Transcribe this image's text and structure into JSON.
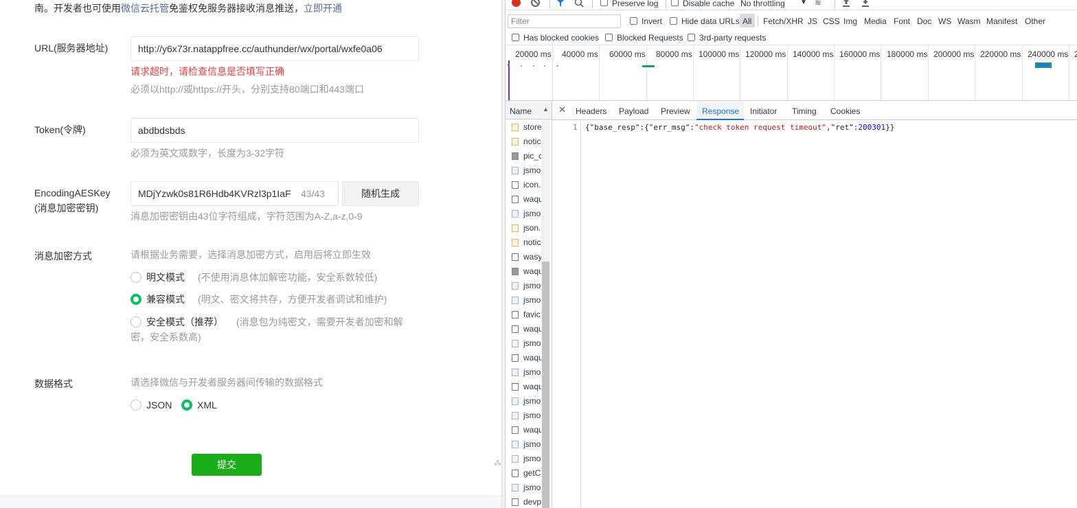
{
  "form": {
    "top_note": {
      "prefix": "南。开发者也可使用",
      "link1": "微信云托管",
      "middle": "免鉴权免服务器接收消息推送，",
      "link2": "立即开通"
    },
    "url": {
      "label": "URL(服务器地址)",
      "value": "http://y6x73r.natappfree.cc/authunder/wx/portal/wxfe0a06",
      "error": "请求超时，请检查信息是否填写正确",
      "hint": "必须以http://或https://开头，分别支持80端口和443端口"
    },
    "token": {
      "label": "Token(令牌)",
      "value": "abdbdsbds",
      "hint": "必须为英文或数字，长度为3-32字符"
    },
    "aeskey": {
      "label_line1": "EncodingAESKey",
      "label_line2": "(消息加密密钥)",
      "value": "MDjYzwk0s81R6Hdb4KVRzl3p1IaF",
      "counter": "43/43",
      "generate_button": "随机生成",
      "hint": "消息加密密钥由43位字符组成，字符范围为A-Z,a-z,0-9"
    },
    "encryption": {
      "label": "消息加密方式",
      "hint": "请根据业务需要，选择消息加密方式，启用后将立即生效",
      "options": [
        {
          "label": "明文模式",
          "desc": "(不使用消息体加解密功能，安全系数较低)",
          "selected": false
        },
        {
          "label": "兼容模式",
          "desc": "(明文、密文将共存，方便开发者调试和维护)",
          "selected": true
        },
        {
          "label": "安全模式（推荐）",
          "desc_line1": "(消息包为纯密文，需要开发者加密和解",
          "desc_line2": "密，安全系数高)",
          "selected": false
        }
      ]
    },
    "format": {
      "label": "数据格式",
      "hint": "请选择微信与开发者服务器间传输的数据格式",
      "options": [
        {
          "label": "JSON",
          "selected": false
        },
        {
          "label": "XML",
          "selected": true
        }
      ]
    },
    "submit": "提交"
  },
  "devtools": {
    "toolbar": {
      "preserve_log": "Preserve log",
      "disable_cache": "Disable cache",
      "throttling": "No throttling"
    },
    "filter": {
      "placeholder": "Filter",
      "invert": "Invert",
      "hide_data_urls": "Hide data URLs"
    },
    "type_filters": [
      "All",
      "Fetch/XHR",
      "JS",
      "CSS",
      "Img",
      "Media",
      "Font",
      "Doc",
      "WS",
      "Wasm",
      "Manifest",
      "Other"
    ],
    "blocked": {
      "has_blocked_cookies": "Has blocked cookies",
      "blocked_requests": "Blocked Requests",
      "third_party": "3rd-party requests"
    },
    "timeline_ticks": [
      "20000 ms",
      "40000 ms",
      "60000 ms",
      "80000 ms",
      "100000 ms",
      "120000 ms",
      "140000 ms",
      "160000 ms",
      "180000 ms",
      "200000 ms",
      "220000 ms",
      "240000 ms",
      "2"
    ],
    "name_header": "Name",
    "requests": [
      {
        "name": "store",
        "type": "json"
      },
      {
        "name": "notic",
        "type": "json"
      },
      {
        "name": "pic_c",
        "type": "img"
      },
      {
        "name": "jsmo",
        "type": "js"
      },
      {
        "name": "icon.",
        "type": "gen"
      },
      {
        "name": "waqu",
        "type": "gen"
      },
      {
        "name": "jsmo",
        "type": "js"
      },
      {
        "name": "json.",
        "type": "json"
      },
      {
        "name": "notic",
        "type": "json"
      },
      {
        "name": "wasy",
        "type": "gen"
      },
      {
        "name": "waqu",
        "type": "img"
      },
      {
        "name": "jsmo",
        "type": "js"
      },
      {
        "name": "jsmo",
        "type": "js"
      },
      {
        "name": "favic",
        "type": "gen"
      },
      {
        "name": "waqu",
        "type": "gen"
      },
      {
        "name": "jsmo",
        "type": "js"
      },
      {
        "name": "waqu",
        "type": "gen"
      },
      {
        "name": "jsmo",
        "type": "js"
      },
      {
        "name": "waqu",
        "type": "gen"
      },
      {
        "name": "jsmo",
        "type": "js"
      },
      {
        "name": "jsmo",
        "type": "js"
      },
      {
        "name": "waqu",
        "type": "gen"
      },
      {
        "name": "jsmo",
        "type": "js"
      },
      {
        "name": "jsmo",
        "type": "js"
      },
      {
        "name": "getC",
        "type": "gen"
      },
      {
        "name": "jsmo",
        "type": "js"
      },
      {
        "name": "devp",
        "type": "gen"
      }
    ],
    "detail_tabs": [
      "Headers",
      "Payload",
      "Preview",
      "Response",
      "Initiator",
      "Timing",
      "Cookies"
    ],
    "active_tab": "Response",
    "response": {
      "line_no": "1",
      "p1": "{\"base_resp\":{\"err_msg\":",
      "s1": "\"check token request timeout\"",
      "p2": ",\"ret\":",
      "n1": "200301",
      "p3": "}}"
    },
    "colors": {
      "active_tab": "#1a73e8",
      "json_string": "#c41a16",
      "json_number": "#1c00cf",
      "record": "#d93025"
    }
  }
}
